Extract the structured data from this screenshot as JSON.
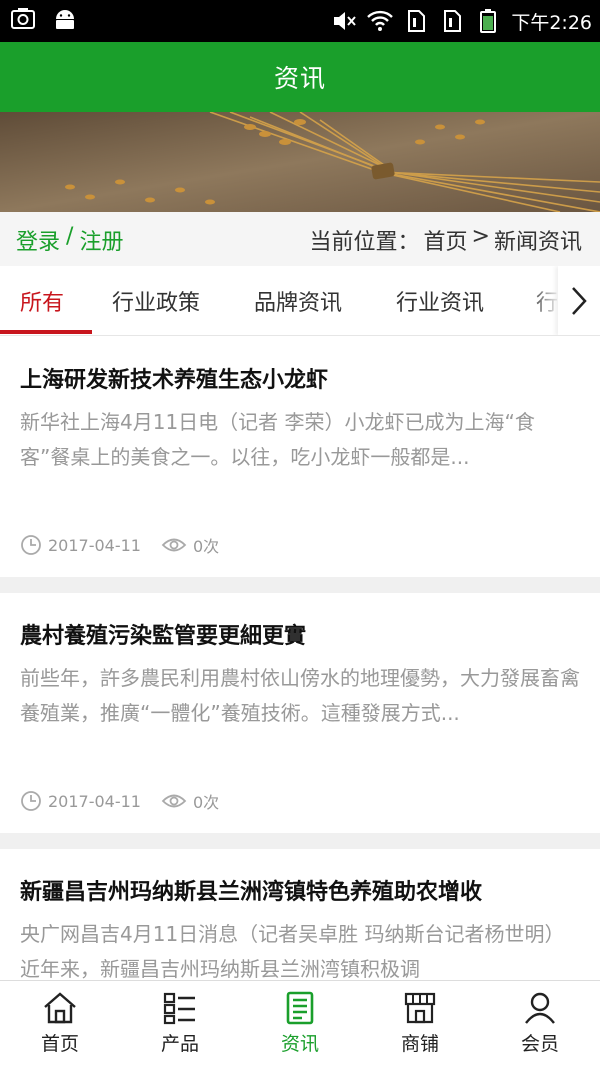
{
  "status_bar": {
    "time": "下午2:26",
    "left_icons": [
      "screenshot-icon",
      "android-icon"
    ],
    "right_icons": [
      "mute-icon",
      "wifi-icon",
      "sim1-icon",
      "sim2-icon",
      "battery-icon"
    ]
  },
  "header": {
    "title": "资讯"
  },
  "banner": {
    "description_icon": "wheat-banner-image"
  },
  "breadcrumb": {
    "login": "登录",
    "slash": "/",
    "register": "注册",
    "location_label": "当前位置：",
    "home": "首页",
    "arrow": ">",
    "current": "新闻资讯"
  },
  "tabs": [
    {
      "label": "所有",
      "active": true
    },
    {
      "label": "行业政策",
      "active": false
    },
    {
      "label": "品牌资讯",
      "active": false
    },
    {
      "label": "行业资讯",
      "active": false
    },
    {
      "label": "行",
      "active": false
    }
  ],
  "articles": [
    {
      "title": "上海研发新技术养殖生态小龙虾",
      "summary": "新华社上海4月11日电（记者 李荣）小龙虾已成为上海“食客”餐桌上的美食之一。以往，吃小龙虾一般都是...",
      "date": "2017-04-11",
      "views": "0次"
    },
    {
      "title": "農村養殖污染監管要更細更實",
      "summary": "前些年，許多農民利用農村依山傍水的地理優勢，大力發展畜禽養殖業，推廣“一體化”養殖技術。這種發展方式...",
      "date": "2017-04-11",
      "views": "0次"
    },
    {
      "title": "新疆昌吉州玛纳斯县兰洲湾镇特色养殖助农增收",
      "summary": "央广网昌吉4月11日消息（记者吴卓胜 玛纳斯台记者杨世明）近年来，新疆昌吉州玛纳斯县兰洲湾镇积极调",
      "date": "",
      "views": ""
    }
  ],
  "bottom_nav": [
    {
      "label": "首页",
      "icon": "home-icon",
      "active": false
    },
    {
      "label": "产品",
      "icon": "product-grid-icon",
      "active": false
    },
    {
      "label": "资讯",
      "icon": "news-icon",
      "active": true
    },
    {
      "label": "商铺",
      "icon": "shop-icon",
      "active": false
    },
    {
      "label": "会员",
      "icon": "member-icon",
      "active": false
    }
  ],
  "colors": {
    "brand_green": "#1a9f2b",
    "active_tab_red": "#c8161d",
    "muted_text": "#999999"
  }
}
